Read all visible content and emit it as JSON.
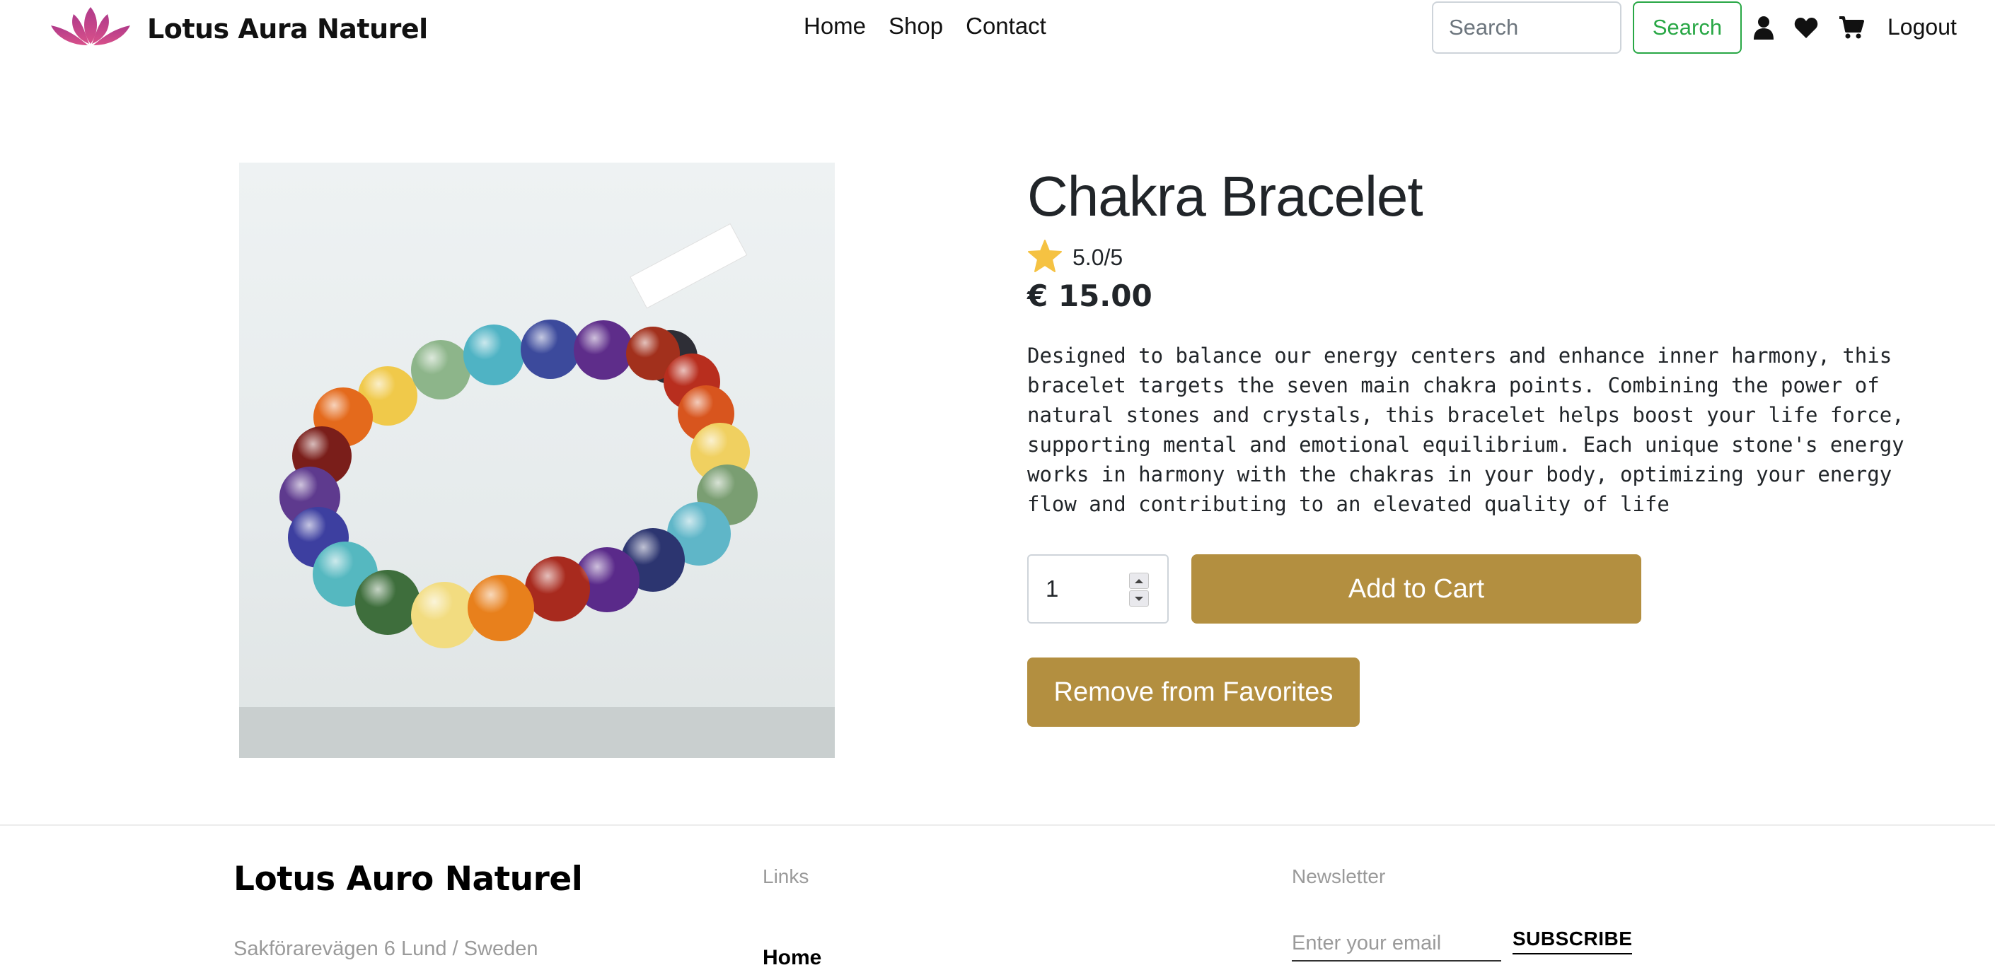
{
  "header": {
    "brand_name": "Lotus Aura Naturel",
    "logo_icon": "lotus-icon",
    "nav": [
      {
        "label": "Home"
      },
      {
        "label": "Shop"
      },
      {
        "label": "Contact"
      }
    ],
    "search_placeholder": "Search",
    "search_button": "Search",
    "icons": [
      "user-icon",
      "heart-icon",
      "cart-icon"
    ],
    "logout_label": "Logout"
  },
  "product": {
    "name": "Chakra Bracelet",
    "rating": 5.0,
    "rating_text": "5.0/5",
    "price": "€ 15.00",
    "description": "Designed to balance our energy centers and enhance inner harmony, this bracelet targets the seven main chakra points. Combining the power of natural stones and crystals, this bracelet helps boost your life force, supporting mental and emotional equilibrium. Each unique stone's energy works in harmony with the chakras in your body, optimizing your energy flow and contributing to an elevated quality of life",
    "quantity": "1",
    "add_to_cart_label": "Add to Cart",
    "remove_favorites_label": "Remove from Favorites"
  },
  "footer": {
    "brand_name": "Lotus Auro Naturel",
    "address": "Sakförarevägen 6 Lund / Sweden",
    "links_heading": "Links",
    "links": [
      {
        "label": "Home"
      }
    ],
    "newsletter_heading": "Newsletter",
    "email_placeholder": "Enter your email",
    "subscribe_label": "SUBSCRIBE"
  },
  "colors": {
    "accent_gold": "#b38f40",
    "search_green": "#28a745",
    "star_yellow": "#f5c242",
    "logo_pink": "#c2407f"
  }
}
